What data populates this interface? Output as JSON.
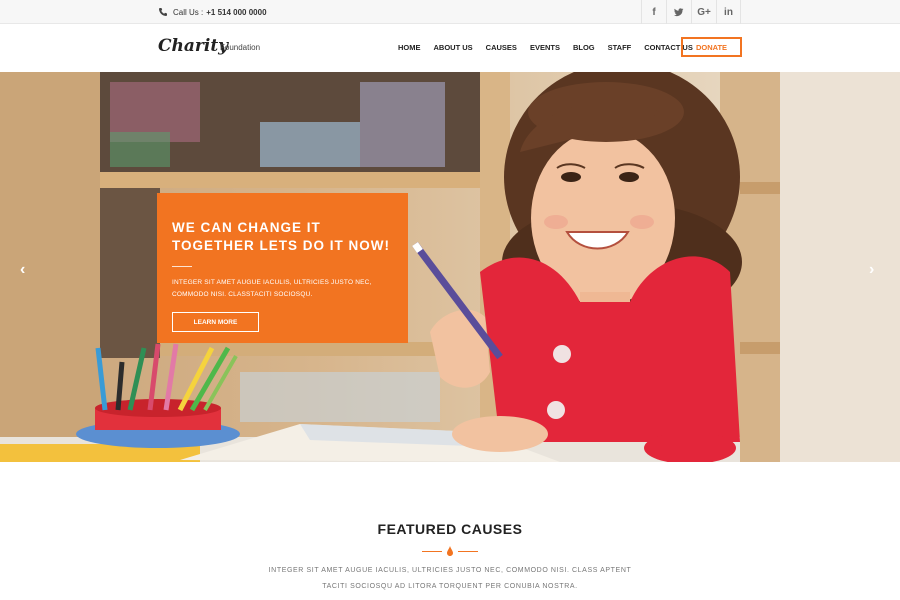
{
  "topbar": {
    "call_label": "Call Us :",
    "phone": "+1 514 000 0000",
    "social": [
      "f",
      "•",
      "G+",
      "in"
    ]
  },
  "header": {
    "logo": "Charity",
    "tagline": "Foundation",
    "nav": [
      "HOME",
      "ABOUT US",
      "CAUSES",
      "EVENTS",
      "BLOG",
      "STAFF",
      "CONTACT US"
    ],
    "donate": "DONATE"
  },
  "hero": {
    "headline_line1": "WE CAN CHANGE IT",
    "headline_line2": "TOGETHER LETS DO IT NOW!",
    "body_line1": "INTEGER SIT AMET AUGUE IACULIS, ULTRICIES JUSTO NEC,",
    "body_line2": "COMMODO NISI. CLASSTACITI SOCIOSQU.",
    "cta": "LEARN MORE",
    "prev_arrow": "‹",
    "next_arrow": "›"
  },
  "featured": {
    "title": "FEATURED CAUSES",
    "desc_line1": "INTEGER SIT AMET AUGUE IACULIS, ULTRICIES JUSTO NEC, COMMODO NISI. CLASS APTENT",
    "desc_line2": "TACITI SOCIOSQU AD LITORA TORQUENT PER CONUBIA NOSTRA."
  },
  "colors": {
    "accent": "#f27421",
    "text_dark": "#222222",
    "text_muted": "#777777"
  }
}
